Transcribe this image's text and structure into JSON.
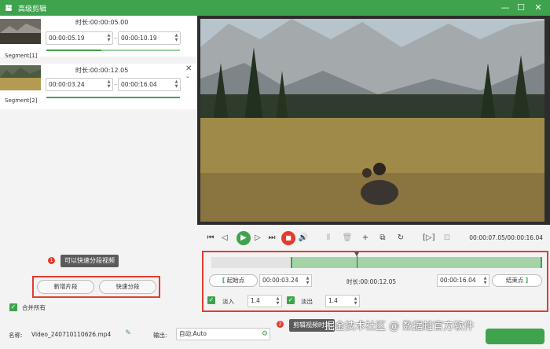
{
  "window": {
    "title": "高级剪辑",
    "minimize": "—",
    "maximize": "☐",
    "close": "✕"
  },
  "segments": [
    {
      "label": "Segment[1]",
      "duration_label": "时长:",
      "duration": "00:00:05.00",
      "start": "00:00:05.19",
      "end": "00:00:10.19",
      "separator": "–"
    },
    {
      "label": "Segment[2]",
      "duration_label": "时长:",
      "duration": "00:00:12.05",
      "start": "00:00:03.24",
      "end": "00:00:16.04",
      "separator": "–"
    }
  ],
  "segment_actions": {
    "new_segment": "新增片段",
    "quick_split": "快速分段"
  },
  "tooltip_split": {
    "badge": "1",
    "text": "可以快速分段视频"
  },
  "merge_all": "合并所有",
  "player": {
    "time": "00:00:07.05/00:00:16.04"
  },
  "editor": {
    "start_btn": "起始点",
    "end_btn": "结束点",
    "start_time": "00:00:03.24",
    "duration_label": "时长:",
    "duration": "00:00:12.05",
    "end_time": "00:00:16.04",
    "fade_in_label": "淡入",
    "fade_in_value": "1.4",
    "fade_out_label": "淡出",
    "fade_out_value": "1.4",
    "start_fraction": 0.24,
    "playhead_fraction": 0.44
  },
  "tooltip_editor": {
    "badge": "2",
    "text": "剪辑视频时长"
  },
  "bottom": {
    "name_label": "名称:",
    "name_value": "Video_240710110626.mp4",
    "output_label": "输出:",
    "output_value": "自动;Auto"
  },
  "watermark": "掘金技术社区 @ 数据蛙官方软件",
  "colors": {
    "accent": "#3fa34d",
    "highlight": "#e63b2e",
    "track_fill": "#a4d4a6"
  }
}
